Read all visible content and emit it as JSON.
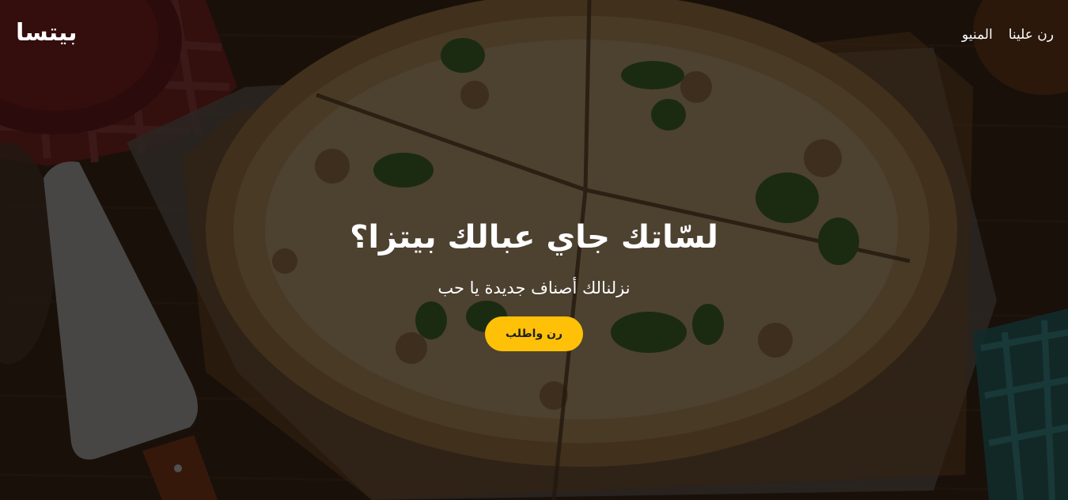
{
  "navbar": {
    "brand": "بيتسا",
    "links": [
      "رن علينا",
      "المنيو"
    ]
  },
  "hero": {
    "title": "لسّاتك جاي عبالك بيتزا؟",
    "subtitle": "نزلنالك أصناف جديدة يا حب",
    "cta_label": "رن واطلب"
  },
  "colors": {
    "accent": "#ffc107",
    "text": "#ffffff",
    "cta_text": "#1e1e1e"
  }
}
